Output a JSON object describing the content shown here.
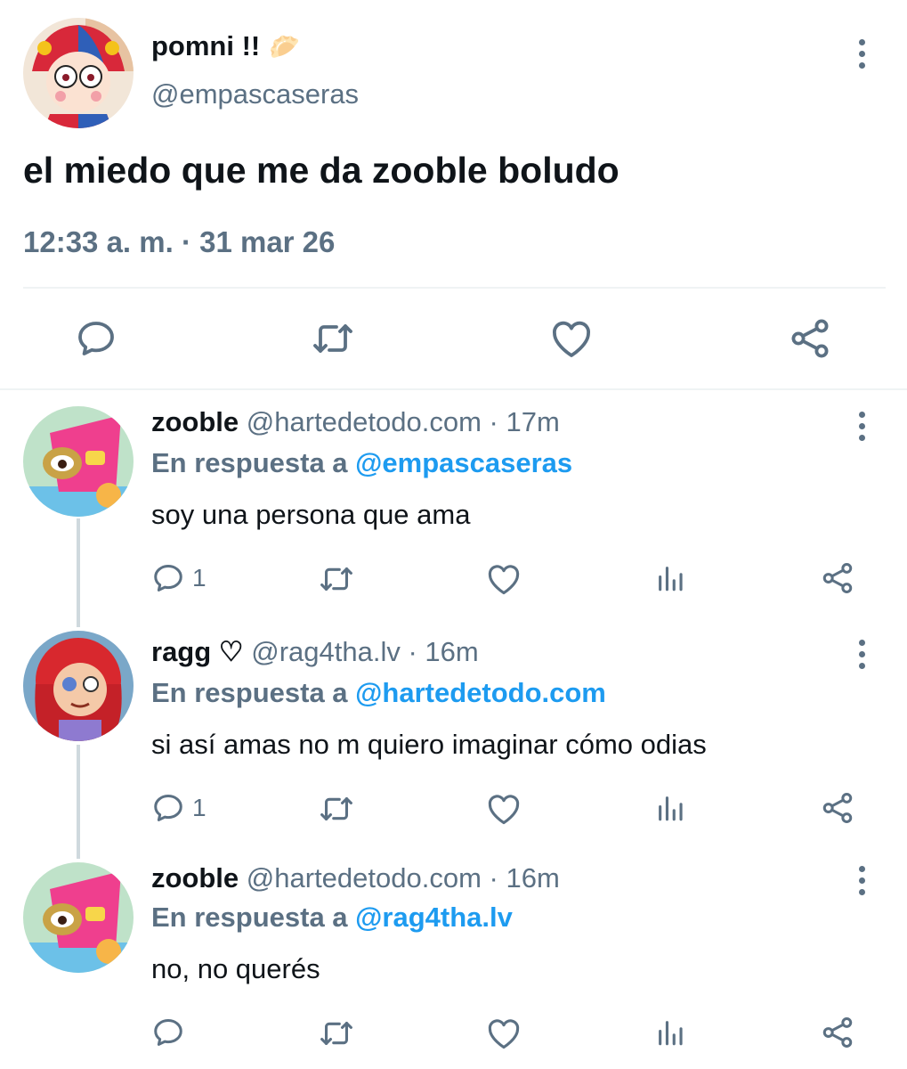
{
  "main_tweet": {
    "display_name": "pomni !!",
    "emoji": "🥟",
    "handle": "@empascaseras",
    "text": "el miedo que me da zooble boludo",
    "timestamp": "12:33 a. m. · 31 mar 26",
    "actions": [
      "reply-icon",
      "retweet-icon",
      "like-icon",
      "share-icon"
    ]
  },
  "replies": [
    {
      "display_name": "zooble",
      "handle": "@hartedetodo.com",
      "time": "· 17m",
      "reply_prefix": "En respuesta a",
      "reply_to": "@empascaseras",
      "text": "soy una persona que ama",
      "reply_count": "1"
    },
    {
      "display_name": "ragg ♡",
      "handle": "@rag4tha.lv",
      "time": "· 16m",
      "reply_prefix": "En respuesta a",
      "reply_to": "@hartedetodo.com",
      "text": "si así amas no m quiero imaginar cómo odias",
      "reply_count": "1"
    },
    {
      "display_name": "zooble",
      "handle": "@hartedetodo.com",
      "time": "· 16m",
      "reply_prefix": "En respuesta a",
      "reply_to": "@rag4tha.lv",
      "text": "no, no querés",
      "reply_count": ""
    }
  ],
  "colors": {
    "text": "#0f1419",
    "secondary": "#5b7083",
    "link": "#1d9bf0",
    "divider": "#eff3f4"
  }
}
